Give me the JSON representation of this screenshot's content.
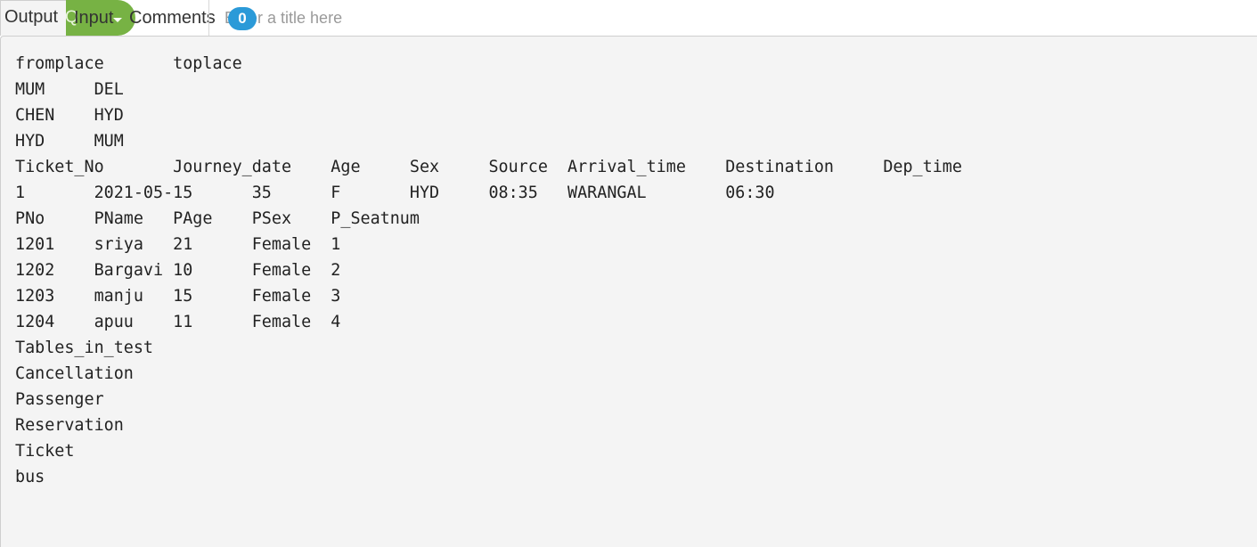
{
  "tabs": {
    "output_label": "Output",
    "input_label": "Input",
    "comments_label": "Comments",
    "ghost_text": "Q"
  },
  "title_field": {
    "placeholder": "Enter a title here",
    "value": ""
  },
  "comments_badge": {
    "count": "0"
  },
  "output": {
    "lines": [
      "fromplace\ttoplace",
      "MUM\tDEL",
      "CHEN\tHYD",
      "HYD\tMUM",
      "Ticket_No\tJourney_date\tAge\tSex\tSource\tArrival_time\tDestination\tDep_time",
      "1\t2021-05-15\t35\tF\tHYD\t08:35\tWARANGAL\t06:30",
      "PNo\tPName\tPAge\tPSex\tP_Seatnum",
      "1201\tsriya\t21\tFemale\t1",
      "1202\tBargavi\t10\tFemale\t2",
      "1203\tmanju\t15\tFemale\t3",
      "1204\tapuu\t11\tFemale\t4",
      "Tables_in_test",
      "Cancellation",
      "Passenger",
      "Reservation",
      "Ticket",
      "bus"
    ]
  },
  "colors": {
    "accent_green": "#77b244",
    "badge_blue": "#2b9ad8",
    "panel_bg": "#f4f4f4"
  }
}
